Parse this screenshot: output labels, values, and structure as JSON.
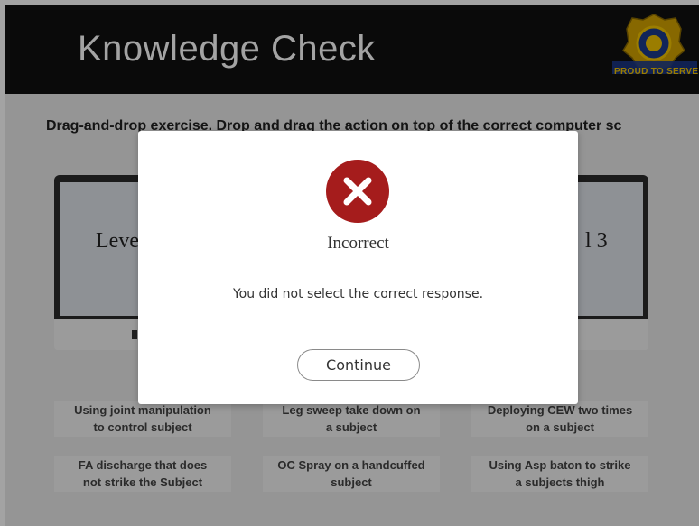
{
  "header": {
    "title": "Knowledge Check",
    "badge_text": "PROUD TO SERVE",
    "badge_icon": "police-badge-logo"
  },
  "instructions": "Drag-and-drop exercise. Drop and drag the action on top of the correct computer sc",
  "monitors": [
    {
      "label": "Leve"
    },
    {
      "label": "l 3"
    }
  ],
  "cards": [
    {
      "line1": "Using joint manipulation",
      "line2": "to control subject"
    },
    {
      "line1": "Leg sweep take down on",
      "line2": "a subject"
    },
    {
      "line1": "Deploying CEW two times",
      "line2": "on a subject"
    },
    {
      "line1": "FA discharge that does",
      "line2": "not strike the Subject"
    },
    {
      "line1": "OC Spray on a handcuffed",
      "line2": "subject"
    },
    {
      "line1": "Using Asp baton to strike",
      "line2": "a subjects thigh"
    }
  ],
  "dialog": {
    "icon": "error-x-icon",
    "title": "Incorrect",
    "message": "You did not select the correct response.",
    "continue_label": "Continue"
  },
  "colors": {
    "header_bg": "#111111",
    "error_red": "#a51c1c",
    "badge_gold": "#f2c400",
    "badge_blue": "#1c3a8c"
  }
}
